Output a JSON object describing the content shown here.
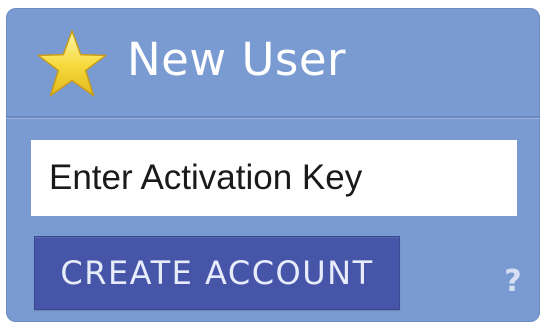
{
  "header": {
    "title": "New User",
    "icon": "star-icon"
  },
  "activation": {
    "placeholder": "Enter Activation Key",
    "value": ""
  },
  "actions": {
    "create_label": "CREATE ACCOUNT",
    "help_label": "?"
  },
  "colors": {
    "panel": "#7a9bd2",
    "button": "#4755a8",
    "star": "#f5d93a"
  }
}
